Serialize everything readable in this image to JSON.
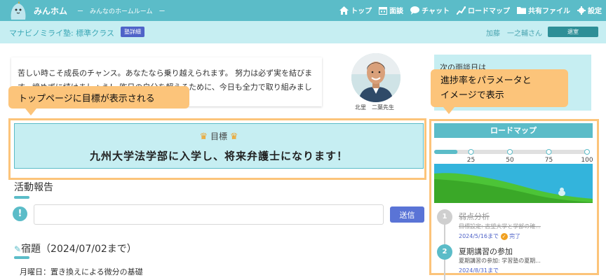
{
  "header": {
    "brand": "みんホム",
    "tagline": "ー　みんなのホームルーム　ー",
    "nav": [
      {
        "label": "トップ",
        "icon": "home-icon"
      },
      {
        "label": "面談",
        "icon": "calendar-icon"
      },
      {
        "label": "チャット",
        "icon": "chat-icon"
      },
      {
        "label": "ロードマップ",
        "icon": "roadmap-icon"
      },
      {
        "label": "共有ファイル",
        "icon": "folder-icon"
      },
      {
        "label": "設定",
        "icon": "gear-icon"
      }
    ]
  },
  "subheader": {
    "class_name": "マナビノミライ塾: 標準クラス",
    "detail_button": "塾詳細",
    "user_name": "加藤　一之輔さん",
    "logout_button": "退室"
  },
  "message": {
    "text": "苦しい時こそ成長のチャンス。あなたなら乗り越えられます。 努力は必ず実を結びます。諦めずに続けましょう！ 昨日の自分を超えるために、今日も全力で取り組みましょう。",
    "teacher_name": "北里　二葉先生"
  },
  "next_meeting": {
    "label": "次の面談日は"
  },
  "callouts": {
    "goal_note": "トップページに目標が表示される",
    "roadmap_note_line1": "進捗率をパラメータと",
    "roadmap_note_line2": "イメージで表示"
  },
  "goal": {
    "label": "目標",
    "text": "九州大学法学部に入学し、将来弁護士になります！"
  },
  "activity": {
    "title": "活動報告",
    "input_value": "",
    "input_placeholder": "",
    "send_button": "送信"
  },
  "homework": {
    "title": "宿題（2024/07/02まで）",
    "items": [
      "月曜日：置き換えによる微分の基礎"
    ]
  },
  "roadmap": {
    "title": "ロードマップ",
    "progress_percent": 15,
    "scale_labels": [
      "25",
      "50",
      "75",
      "100"
    ],
    "steps": [
      {
        "number": "1",
        "title": "弱点分析",
        "desc": "目標設定: 志望大学と学部の確...",
        "due": "2024/5/16まで",
        "status": "完了",
        "completed": true
      },
      {
        "number": "2",
        "title": "夏期講習の参加",
        "desc": "夏期講習の参加: 学習塾の夏期...",
        "due": "2024/8/31まで",
        "status": "",
        "completed": false
      }
    ]
  },
  "colors": {
    "primary": "#5bbcc8",
    "light": "#c6eef2",
    "accent_orange": "#fcc47a",
    "button_blue": "#5a74d6",
    "dark_teal": "#2e8f97"
  }
}
